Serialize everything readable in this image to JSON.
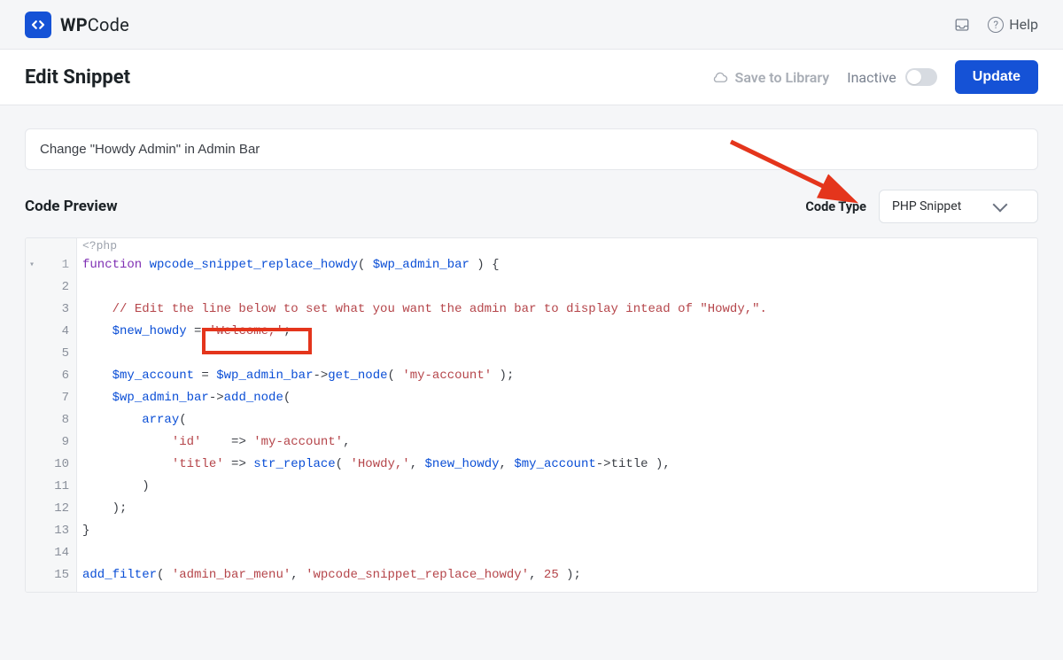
{
  "brand": {
    "name_bold": "WP",
    "name_thin": "Code"
  },
  "topbar": {
    "help_label": "Help"
  },
  "header": {
    "title": "Edit Snippet",
    "save_library_label": "Save to Library",
    "status_label": "Inactive",
    "update_label": "Update"
  },
  "snippet": {
    "title_value": "Change \"Howdy Admin\" in Admin Bar"
  },
  "preview": {
    "label": "Code Preview"
  },
  "codetype": {
    "label": "Code Type",
    "selected": "PHP Snippet"
  },
  "editor": {
    "php_tag": "<?php",
    "lines": [
      [
        {
          "t": "function ",
          "c": "tok-kw"
        },
        {
          "t": "wpcode_snippet_replace_howdy",
          "c": "tok-fn"
        },
        {
          "t": "( ",
          "c": "tok-punc"
        },
        {
          "t": "$wp_admin_bar",
          "c": "tok-var"
        },
        {
          "t": " ) {",
          "c": "tok-punc"
        }
      ],
      [
        {
          "t": "",
          "c": ""
        }
      ],
      [
        {
          "t": "    ",
          "c": ""
        },
        {
          "t": "// Edit the line below to set what you want the admin bar to display intead of \"Howdy,\".",
          "c": "tok-comm"
        }
      ],
      [
        {
          "t": "    ",
          "c": ""
        },
        {
          "t": "$new_howdy",
          "c": "tok-var"
        },
        {
          "t": " = ",
          "c": "tok-punc"
        },
        {
          "t": "'Welcome,'",
          "c": "tok-str"
        },
        {
          "t": ";",
          "c": "tok-punc"
        }
      ],
      [
        {
          "t": "",
          "c": ""
        }
      ],
      [
        {
          "t": "    ",
          "c": ""
        },
        {
          "t": "$my_account",
          "c": "tok-var"
        },
        {
          "t": " = ",
          "c": "tok-punc"
        },
        {
          "t": "$wp_admin_bar",
          "c": "tok-var"
        },
        {
          "t": "->",
          "c": "tok-punc"
        },
        {
          "t": "get_node",
          "c": "tok-fn"
        },
        {
          "t": "( ",
          "c": "tok-punc"
        },
        {
          "t": "'my-account'",
          "c": "tok-str"
        },
        {
          "t": " );",
          "c": "tok-punc"
        }
      ],
      [
        {
          "t": "    ",
          "c": ""
        },
        {
          "t": "$wp_admin_bar",
          "c": "tok-var"
        },
        {
          "t": "->",
          "c": "tok-punc"
        },
        {
          "t": "add_node",
          "c": "tok-fn"
        },
        {
          "t": "(",
          "c": "tok-punc"
        }
      ],
      [
        {
          "t": "        ",
          "c": ""
        },
        {
          "t": "array",
          "c": "tok-fn"
        },
        {
          "t": "(",
          "c": "tok-punc"
        }
      ],
      [
        {
          "t": "            ",
          "c": ""
        },
        {
          "t": "'id'",
          "c": "tok-str"
        },
        {
          "t": "    => ",
          "c": "tok-punc"
        },
        {
          "t": "'my-account'",
          "c": "tok-str"
        },
        {
          "t": ",",
          "c": "tok-punc"
        }
      ],
      [
        {
          "t": "            ",
          "c": ""
        },
        {
          "t": "'title'",
          "c": "tok-str"
        },
        {
          "t": " => ",
          "c": "tok-punc"
        },
        {
          "t": "str_replace",
          "c": "tok-fn"
        },
        {
          "t": "( ",
          "c": "tok-punc"
        },
        {
          "t": "'Howdy,'",
          "c": "tok-str"
        },
        {
          "t": ", ",
          "c": "tok-punc"
        },
        {
          "t": "$new_howdy",
          "c": "tok-var"
        },
        {
          "t": ", ",
          "c": "tok-punc"
        },
        {
          "t": "$my_account",
          "c": "tok-var"
        },
        {
          "t": "->title ),",
          "c": "tok-punc"
        }
      ],
      [
        {
          "t": "        )",
          "c": "tok-punc"
        }
      ],
      [
        {
          "t": "    );",
          "c": "tok-punc"
        }
      ],
      [
        {
          "t": "}",
          "c": "tok-punc"
        }
      ],
      [
        {
          "t": "",
          "c": ""
        }
      ],
      [
        {
          "t": "add_filter",
          "c": "tok-fn"
        },
        {
          "t": "( ",
          "c": "tok-punc"
        },
        {
          "t": "'admin_bar_menu'",
          "c": "tok-str"
        },
        {
          "t": ", ",
          "c": "tok-punc"
        },
        {
          "t": "'wpcode_snippet_replace_howdy'",
          "c": "tok-str"
        },
        {
          "t": ", ",
          "c": "tok-punc"
        },
        {
          "t": "25",
          "c": "tok-num"
        },
        {
          "t": " );",
          "c": "tok-punc"
        }
      ]
    ]
  }
}
